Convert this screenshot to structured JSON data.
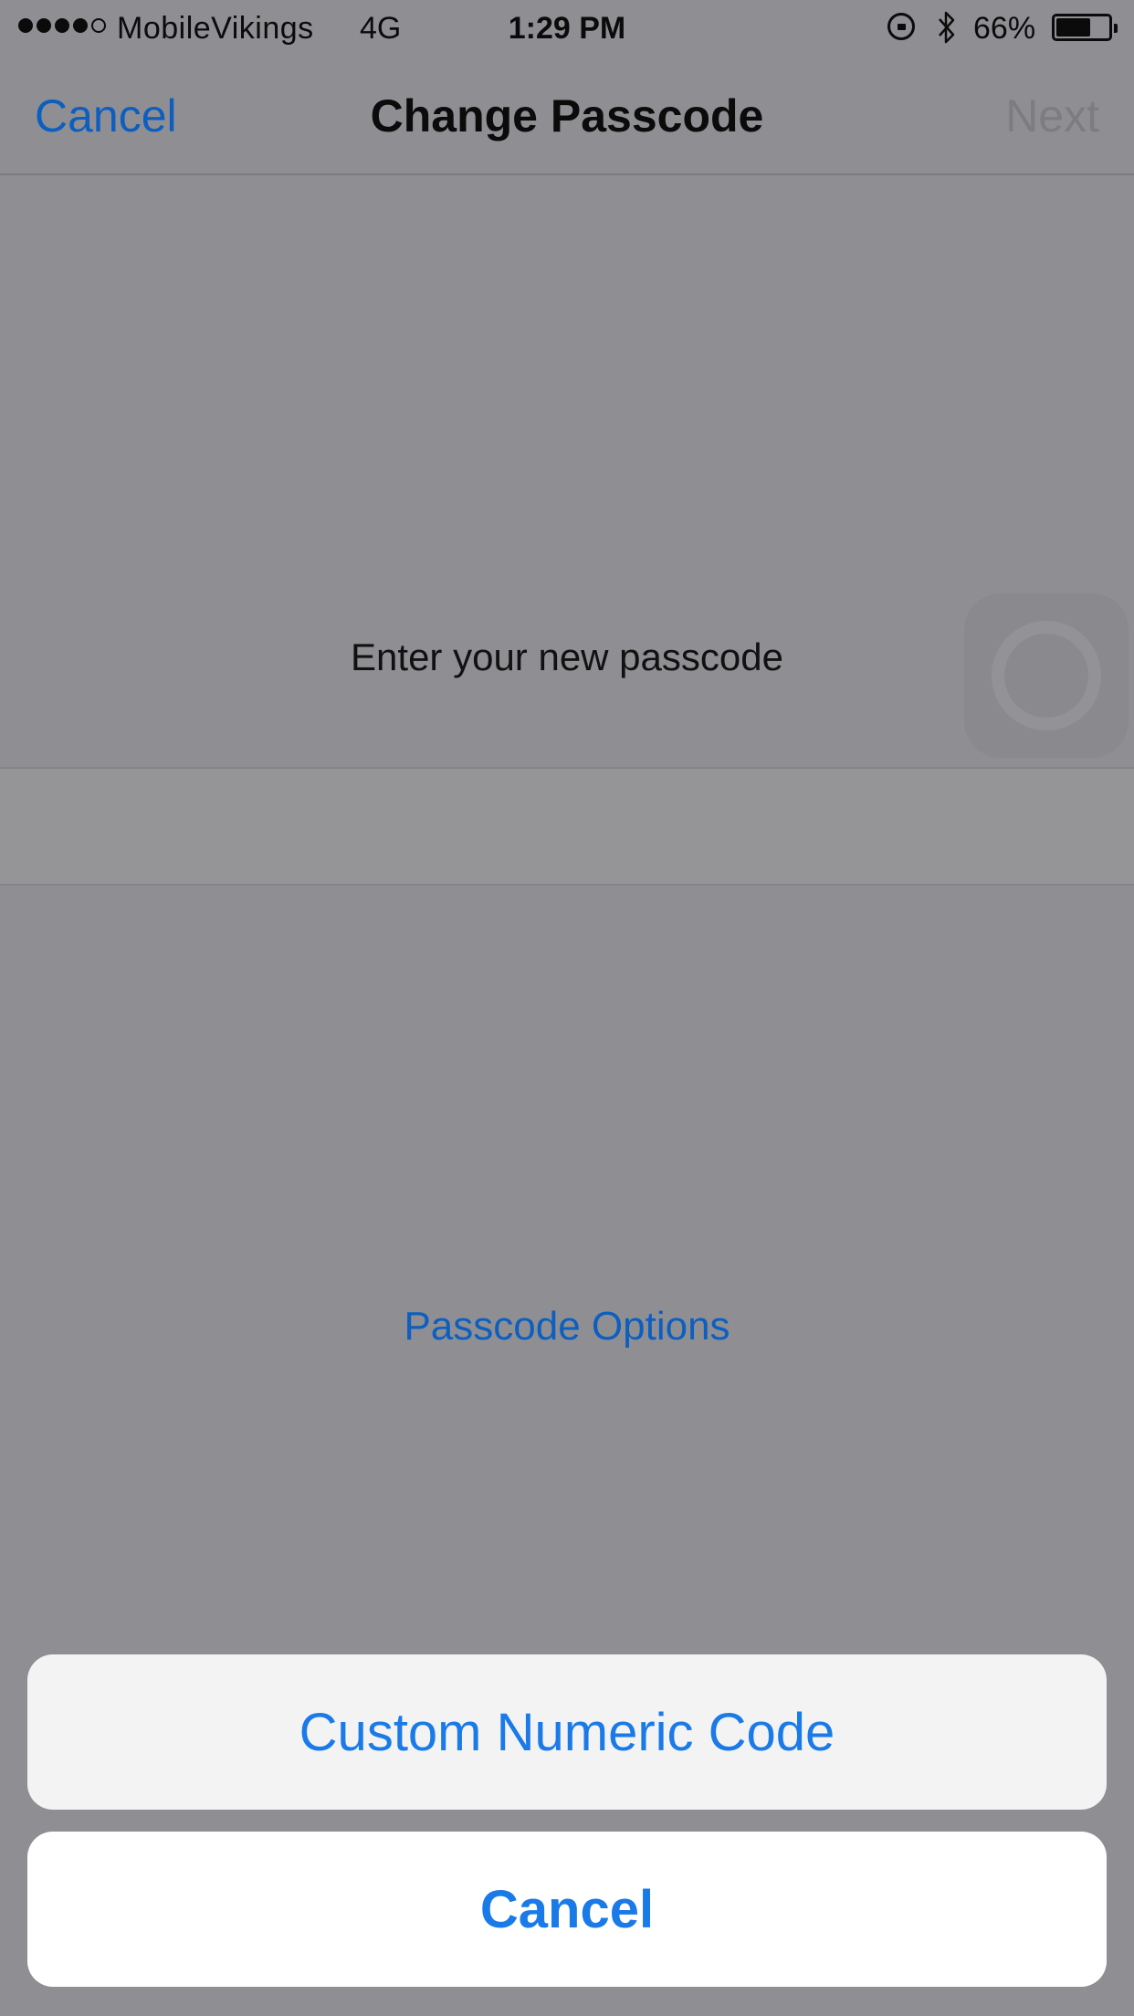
{
  "status_bar": {
    "carrier": "MobileVikings",
    "network": "4G",
    "time": "1:29 PM",
    "battery_percent": "66%",
    "battery_level": 0.66,
    "signal_bars_filled": 4,
    "signal_bars_total": 5
  },
  "nav": {
    "cancel_label": "Cancel",
    "title": "Change Passcode",
    "next_label": "Next"
  },
  "content": {
    "prompt": "Enter your new passcode",
    "passcode_options_label": "Passcode Options"
  },
  "action_sheet": {
    "option_label": "Custom Numeric Code",
    "cancel_label": "Cancel"
  },
  "colors": {
    "accent": "#1a7ae8",
    "dimmed_accent": "#0d5fbf",
    "disabled": "#7d7d80"
  }
}
